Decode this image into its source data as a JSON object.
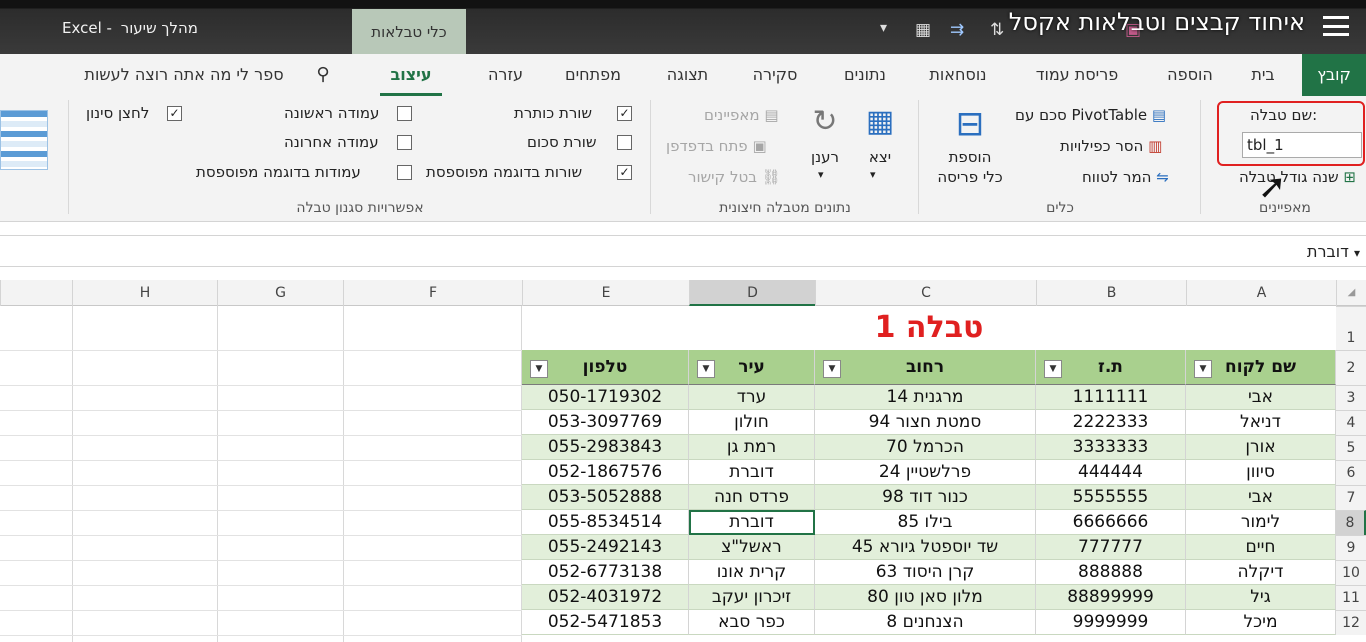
{
  "video": {
    "title": "איחוד קבצים וטבלאות אקסל",
    "app_name": "Excel",
    "doc_name": "מהלך שיעור",
    "contextual_tab": "כלי טבלאות"
  },
  "tabs": [
    "קובץ",
    "בית",
    "הוספה",
    "פריסת עמוד",
    "נוסחאות",
    "נתונים",
    "סקירה",
    "תצוגה",
    "מפתחים",
    "עזרה",
    "עיצוב"
  ],
  "tell_me": "ספר לי מה אתה רוצה לעשות",
  "ribbon": {
    "properties": {
      "label": "שם טבלה:",
      "value": "tbl_1",
      "resize": "שנה גודל טבלה",
      "group": "מאפיינים"
    },
    "tools": {
      "pivot": "סכם עם PivotTable",
      "dedupe": "הסר כפילויות",
      "convert": "המר לטווח",
      "slicer_1": "הוספת",
      "slicer_2": "כלי פריסה",
      "group": "כלים"
    },
    "external": {
      "export": "יצא",
      "refresh": "רענן",
      "properties": "מאפיינים",
      "open_browser": "פתח בדפדפן",
      "unlink": "בטל קישור",
      "group": "נתונים מטבלה חיצונית"
    },
    "style_options": {
      "header_row": "שורת כותרת",
      "total_row": "שורת סכום",
      "banded_rows": "שורות בדוגמה מפוספסת",
      "first_col": "עמודה ראשונה",
      "last_col": "עמודה אחרונה",
      "banded_cols": "עמודות בדוגמה מפוספסת",
      "filter_btn": "לחצן סינון",
      "group": "אפשרויות סגנון טבלה"
    }
  },
  "formula": {
    "name_box": "דוברת"
  },
  "columns": [
    "A",
    "B",
    "C",
    "D",
    "E",
    "F",
    "G",
    "H"
  ],
  "rows": [
    "1",
    "2",
    "3",
    "4",
    "5",
    "6",
    "7",
    "8",
    "9",
    "10",
    "11",
    "12"
  ],
  "table": {
    "title": "טבלה 1",
    "headers": [
      "שם לקוח",
      "ת.ז",
      "רחוב",
      "עיר",
      "טלפון"
    ],
    "data": [
      [
        "אבי",
        "1111111",
        "מרגנית 14",
        "ערד",
        "050-1719302"
      ],
      [
        "דניאל",
        "2222333",
        "סמטת חצור 94",
        "חולון",
        "053-3097769"
      ],
      [
        "אורן",
        "3333333",
        "הכרמל 70",
        "רמת גן",
        "055-2983843"
      ],
      [
        "סיוון",
        "444444",
        "פרלשטיין 24",
        "דוברת",
        "052-1867576"
      ],
      [
        "אבי",
        "5555555",
        "כנור דוד 98",
        "פרדס חנה",
        "053-5052888"
      ],
      [
        "לימור",
        "6666666",
        "בילו 85",
        "דוברת",
        "055-8534514"
      ],
      [
        "חיים",
        "777777",
        "שד יוספטל גיורא 45",
        "ראשל\"צ",
        "055-2492143"
      ],
      [
        "דיקלה",
        "888888",
        "קרן היסוד 63",
        "קרית אונו",
        "052-6773138"
      ],
      [
        "גיל",
        "88899999",
        "מלון סאן טון 80",
        "זיכרון יעקב",
        "052-4031972"
      ],
      [
        "מיכל",
        "9999999",
        "הצנחנים 8",
        "כפר סבא",
        "052-5471853"
      ]
    ]
  },
  "colors": {
    "accent": "#217346",
    "header_fill": "#a9d08e",
    "band_fill": "#e2efda",
    "highlight": "#e02020"
  }
}
